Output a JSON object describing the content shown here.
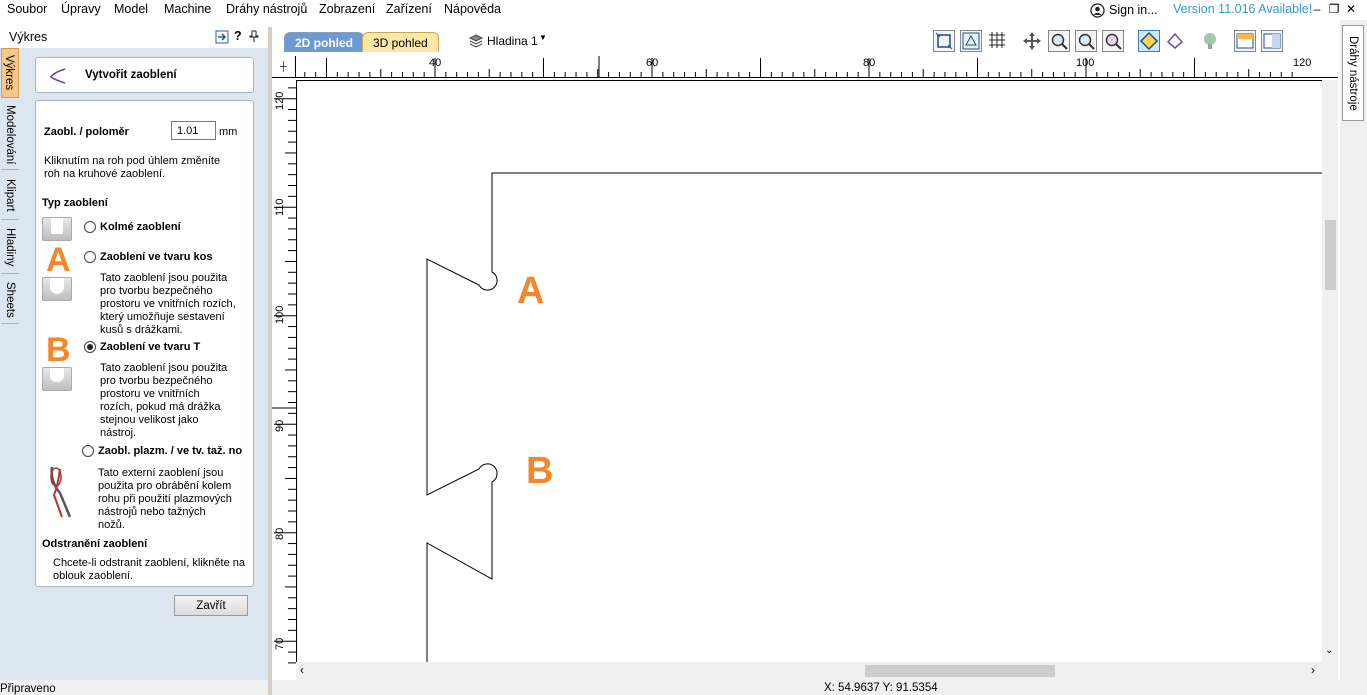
{
  "menu": {
    "items": [
      "Soubor",
      "Úpravy",
      "Model",
      "Machine",
      "Dráhy nástrojů",
      "Zobrazení",
      "Zařízení",
      "Nápověda"
    ],
    "sign_in": "Sign in...",
    "version": "Version 11.016 Available!"
  },
  "panel": {
    "header_title": "Výkres",
    "header_buttons": [
      "pin-icon",
      "help",
      "pin"
    ],
    "left_tabs": [
      "Výkres",
      "Modelování",
      "Klipart",
      "Hladiny",
      "Sheets"
    ],
    "title": "Vytvořit zaoblení",
    "radius_label": "Zaobl. / poloměr",
    "radius_value": "1.01",
    "radius_unit": "mm",
    "hint": [
      "Kliknutím na roh pod úhlem změníte",
      "roh na kruhové zaoblení."
    ],
    "type_heading": "Typ zaoblení",
    "options": [
      {
        "label": "Kolmé zaoblení",
        "selected": false,
        "desc": []
      },
      {
        "label": "Zaoblení ve tvaru kos",
        "selected": false,
        "desc": [
          "Tato zaoblení jsou použita",
          "pro tvorbu bezpečného",
          "prostoru ve vnitřních rozích,",
          "který umožňuje sestavení",
          "kusů s drážkami."
        ]
      },
      {
        "label": "Zaoblení ve tvaru T",
        "selected": true,
        "desc": [
          "Tato zaoblení jsou použita",
          "pro tvorbu bezpečného",
          "prostoru ve vnitřních",
          "rozích, pokud má drážka",
          "stejnou velikost jako",
          "nástroj."
        ]
      },
      {
        "label": "Zaobl. plazm. / ve tv. taž. no",
        "selected": false,
        "desc": [
          "Tato externí zaoblení jsou",
          "použita pro obrábění kolem",
          "rohu při použití plazmových",
          "nástrojů nebo tažných",
          "nožů."
        ]
      }
    ],
    "remove_heading": "Odstranění zaoblení",
    "remove_text": [
      "Chcete-li odstranit zaoblení, klikněte na",
      "oblouk zaoblení."
    ],
    "close_label": "Zavřít",
    "annot_a": "A",
    "annot_b": "B"
  },
  "view": {
    "tab_2d": "2D pohled",
    "tab_3d": "3D pohled",
    "layer": "Hladina 1",
    "ruler_top": [
      "40",
      "60",
      "80",
      "100",
      "120"
    ],
    "ruler_left": [
      "120",
      "110",
      "100",
      "90",
      "80",
      "70"
    ],
    "annot_a": "A",
    "annot_b": "B"
  },
  "right_tab": "Dráhy nástroje",
  "status": {
    "left": "Připraveno",
    "coords": "X: 54.9637 Y: 91.5354"
  },
  "colors": {
    "accent": "#f5862a",
    "version": "#3399cc",
    "panel_bg": "#dce6f0"
  }
}
